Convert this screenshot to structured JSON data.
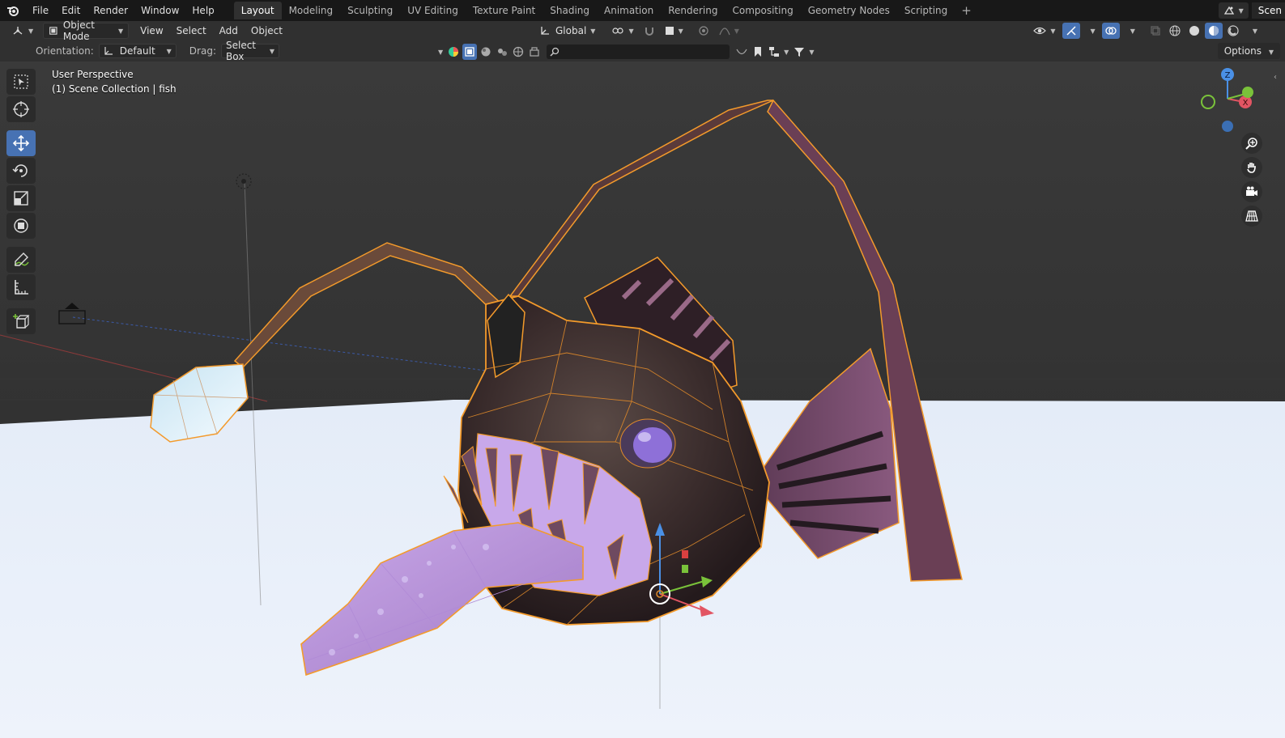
{
  "menu": {
    "items": [
      "File",
      "Edit",
      "Render",
      "Window",
      "Help"
    ]
  },
  "workspaces": {
    "tabs": [
      "Layout",
      "Modeling",
      "Sculpting",
      "UV Editing",
      "Texture Paint",
      "Shading",
      "Animation",
      "Rendering",
      "Compositing",
      "Geometry Nodes",
      "Scripting"
    ],
    "active": "Layout",
    "add_symbol": "+"
  },
  "scene": {
    "name": "Scen"
  },
  "header": {
    "mode": "Object Mode",
    "menus": [
      "View",
      "Select",
      "Add",
      "Object"
    ],
    "transform_orientation": "Global"
  },
  "tool_settings": {
    "orientation_label": "Orientation:",
    "orientation_value": "Default",
    "drag_label": "Drag:",
    "drag_value": "Select Box",
    "options_label": "Options"
  },
  "viewport": {
    "view_name": "User Perspective",
    "collection_info": "(1) Scene Collection | fish",
    "accent": "#4772b3",
    "selection_outline": "#f39a2b"
  },
  "toolbar": {
    "tools": [
      "select-box",
      "cursor",
      "move",
      "rotate",
      "scale",
      "transform",
      "annotate",
      "measure",
      "add-cube"
    ],
    "active": "move"
  },
  "gizmo": {
    "x": "X",
    "y": "Y",
    "z": "Z"
  }
}
